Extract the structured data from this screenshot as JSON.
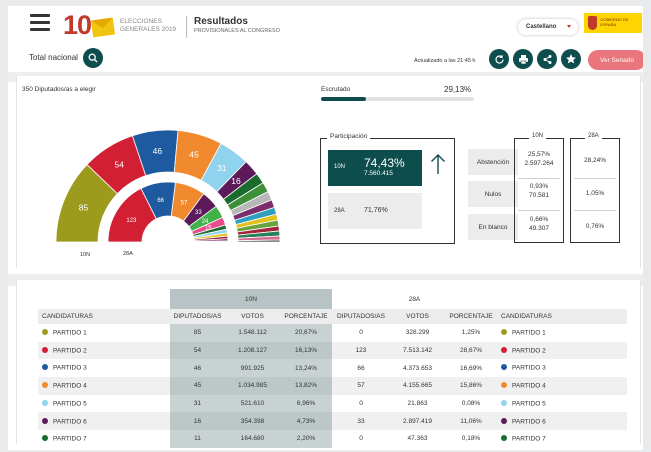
{
  "header": {
    "logo_number": "10",
    "logo_text": "ELECCIONES GENERALES 2019",
    "title": "Resultados",
    "subtitle": "PROVISIONALES AL CONGRESO",
    "language": "Castellano",
    "total_label": "Total nacional",
    "updated": "Actualizado a las 21:45 h",
    "senado_button": "Ver Senado",
    "gov_text": "GOBIERNO DE ESPAÑA"
  },
  "summary": {
    "seats_label": "350 Diputados/as a elegir",
    "escrutado_label": "Escrutado",
    "escrutado_value": "29,13%",
    "escrutado_fraction": 0.2913
  },
  "hemicycle": {
    "outer_label": "10N",
    "inner_label": "28A",
    "outer": [
      {
        "seats": 85,
        "color": "#9d9b1d",
        "label": "85"
      },
      {
        "seats": 54,
        "color": "#d21f34",
        "label": "54"
      },
      {
        "seats": 46,
        "color": "#1e5aa0",
        "label": "46"
      },
      {
        "seats": 45,
        "color": "#f18a2f",
        "label": "45"
      },
      {
        "seats": 31,
        "color": "#8fd3ef",
        "label": "31"
      },
      {
        "seats": 16,
        "color": "#5c1a5a",
        "label": "16"
      },
      {
        "seats": 11,
        "color": "#1a6b2e",
        "label": ""
      },
      {
        "seats": 10,
        "color": "#3f8f3a",
        "label": ""
      },
      {
        "seats": 9,
        "color": "#b7b7b7",
        "label": ""
      },
      {
        "seats": 8,
        "color": "#7b2e6c",
        "label": ""
      },
      {
        "seats": 7,
        "color": "#2f9fbf",
        "label": ""
      },
      {
        "seats": 6,
        "color": "#e0c21a",
        "label": ""
      },
      {
        "seats": 6,
        "color": "#6aa23b",
        "label": ""
      },
      {
        "seats": 5,
        "color": "#a32638",
        "label": ""
      },
      {
        "seats": 5,
        "color": "#2c7f5b",
        "label": ""
      },
      {
        "seats": 4,
        "color": "#d46a8c",
        "label": ""
      },
      {
        "seats": 2,
        "color": "#444444",
        "label": ""
      }
    ],
    "inner": [
      {
        "seats": 123,
        "color": "#d21f34",
        "label": "123"
      },
      {
        "seats": 66,
        "color": "#1e5aa0",
        "label": "66"
      },
      {
        "seats": 57,
        "color": "#f18a2f",
        "label": "57"
      },
      {
        "seats": 33,
        "color": "#5c1a5a",
        "label": "33"
      },
      {
        "seats": 24,
        "color": "#3fb34a",
        "label": "24"
      },
      {
        "seats": 15,
        "color": "#e84c8b",
        "label": "15"
      },
      {
        "seats": 8,
        "color": "#1a6b2e",
        "label": ""
      },
      {
        "seats": 7,
        "color": "#8fd3ef",
        "label": ""
      },
      {
        "seats": 6,
        "color": "#e0c21a",
        "label": ""
      },
      {
        "seats": 5,
        "color": "#a32638",
        "label": ""
      },
      {
        "seats": 4,
        "color": "#7b2e6c",
        "label": ""
      },
      {
        "seats": 2,
        "color": "#b7b7b7",
        "label": ""
      }
    ]
  },
  "participation": {
    "title": "Participación",
    "n10_label": "10N",
    "n10_pct": "74,43%",
    "n10_abs": "7.560.415",
    "n28_label": "28A",
    "n28_pct": "71,76%"
  },
  "stats": {
    "col10": "10N",
    "col28": "28A",
    "rows": [
      {
        "label": "Abstención",
        "v10_pct": "25,57%",
        "v10_abs": "2.597.264",
        "v28": "28,24%"
      },
      {
        "label": "Nulos",
        "v10_pct": "0,93%",
        "v10_abs": "70.581",
        "v28": "1,05%"
      },
      {
        "label": "En blanco",
        "v10_pct": "0,66%",
        "v10_abs": "49.307",
        "v28": "0,76%"
      }
    ]
  },
  "table": {
    "group10": "10N",
    "group28": "28A",
    "headers": [
      "CANDIDATURAS",
      "DIPUTADOS/AS",
      "VOTOS",
      "PORCENTAJE",
      "DIPUTADOS/AS",
      "VOTOS",
      "PORCENTAJE",
      "CANDIDATURAS"
    ],
    "rows": [
      {
        "party": "PARTIDO 1",
        "color": "#9d9b1d",
        "d10": "85",
        "v10": "1.548.112",
        "p10": "20,67%",
        "d28": "0",
        "v28": "328.299",
        "p28": "1,25%"
      },
      {
        "party": "PARTIDO 2",
        "color": "#d21f34",
        "d10": "54",
        "v10": "1.208.127",
        "p10": "16,13%",
        "d28": "123",
        "v28": "7.513.142",
        "p28": "28,67%"
      },
      {
        "party": "PARTIDO 3",
        "color": "#1e5aa0",
        "d10": "46",
        "v10": "991.925",
        "p10": "13,24%",
        "d28": "66",
        "v28": "4.373.653",
        "p28": "16,69%"
      },
      {
        "party": "PARTIDO 4",
        "color": "#f18a2f",
        "d10": "45",
        "v10": "1.034.985",
        "p10": "13,82%",
        "d28": "57",
        "v28": "4.155.665",
        "p28": "15,86%"
      },
      {
        "party": "PARTIDO 5",
        "color": "#8fd3ef",
        "d10": "31",
        "v10": "521.610",
        "p10": "6,96%",
        "d28": "0",
        "v28": "21.863",
        "p28": "0,08%"
      },
      {
        "party": "PARTIDO 6",
        "color": "#5c1a5a",
        "d10": "16",
        "v10": "354.398",
        "p10": "4,73%",
        "d28": "33",
        "v28": "2.897.419",
        "p28": "11,06%"
      },
      {
        "party": "PARTIDO 7",
        "color": "#1a6b2e",
        "d10": "11",
        "v10": "164.680",
        "p10": "2,20%",
        "d28": "0",
        "v28": "47.363",
        "p28": "0,18%"
      }
    ]
  }
}
